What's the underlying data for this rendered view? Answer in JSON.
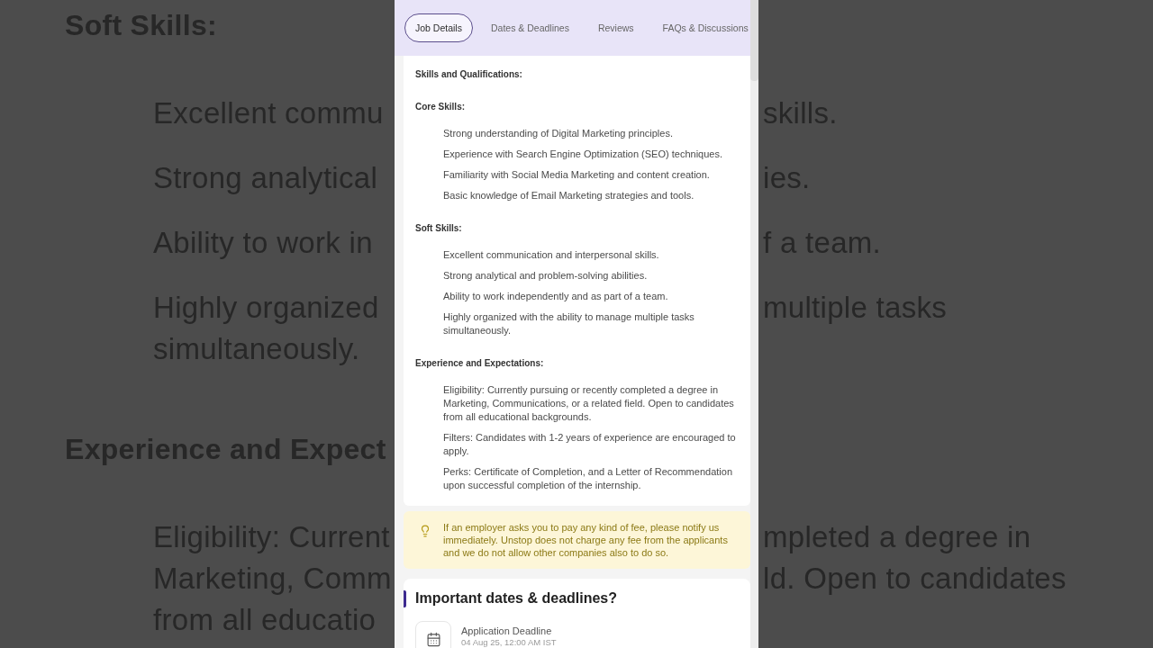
{
  "backdrop": {
    "lines": [
      {
        "kind": "heading",
        "left": "Soft Skills:"
      },
      {
        "kind": "item",
        "left": "Excellent commu",
        "right": "skills."
      },
      {
        "kind": "item",
        "left": "Strong analytical",
        "right": "ies."
      },
      {
        "kind": "item",
        "left": "Ability to work in",
        "right": "f a team."
      },
      {
        "kind": "item",
        "left": "Highly organized",
        "right": "multiple tasks"
      },
      {
        "kind": "wrap",
        "left": "simultaneously."
      },
      {
        "kind": "heading",
        "left": "Experience and Expect"
      },
      {
        "kind": "item",
        "left": "Eligibility: Current",
        "right": "mpleted a degree in"
      },
      {
        "kind": "wrap",
        "left": "Marketing, Comm",
        "right": "ld. Open to candidates"
      },
      {
        "kind": "wrap",
        "left": "from all educatio"
      }
    ]
  },
  "tabs": [
    {
      "label": "Job Details",
      "selected": true
    },
    {
      "label": "Dates & Deadlines",
      "selected": false
    },
    {
      "label": "Reviews",
      "selected": false
    },
    {
      "label": "FAQs & Discussions",
      "selected": false
    }
  ],
  "job_details": {
    "title": "Skills and Qualifications:",
    "groups": [
      {
        "title": "Core Skills:",
        "items": [
          "Strong understanding of Digital Marketing principles.",
          "Experience with Search Engine Optimization (SEO) techniques.",
          "Familiarity with Social Media Marketing and content creation.",
          "Basic knowledge of Email Marketing strategies and tools."
        ]
      },
      {
        "title": "Soft Skills:",
        "items": [
          "Excellent communication and interpersonal skills.",
          "Strong analytical and problem-solving abilities.",
          "Ability to work independently and as part of a team.",
          "Highly organized with the ability to manage multiple tasks simultaneously."
        ]
      },
      {
        "title": "Experience and Expectations:",
        "items": [
          "Eligibility: Currently pursuing or recently completed a degree in Marketing, Communications, or a related field. Open to candidates from all educational backgrounds.",
          "Filters: Candidates with 1-2 years of experience are encouraged to apply.",
          "Perks: Certificate of Completion, and a Letter of Recommendation upon successful completion of the internship."
        ]
      }
    ]
  },
  "notice": {
    "text": "If an employer asks you to pay any kind of fee, please notify us immediately. Unstop does not charge any fee from the applicants and we do not allow other companies also to do so."
  },
  "dates": {
    "title": "Important dates & deadlines?",
    "items": [
      {
        "label": "Application Deadline",
        "value": "04 Aug 25, 12:00 AM IST"
      }
    ]
  }
}
